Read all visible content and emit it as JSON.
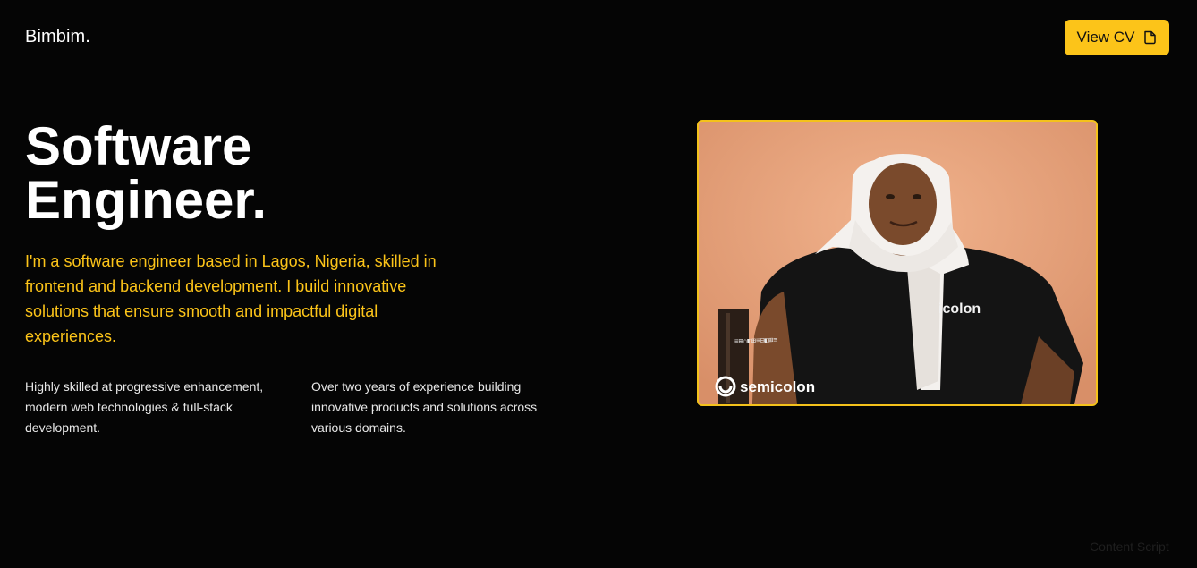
{
  "header": {
    "logo": "Bimbim.",
    "cv_button_label": "View CV"
  },
  "hero": {
    "headline_line1": "Software",
    "headline_line2": "Engineer.",
    "intro": "I'm a software engineer based in Lagos, Nigeria, skilled in frontend and backend development. I build innovative solutions that ensure smooth and impactful digital experiences.",
    "highlights": [
      "Highly skilled at progressive enhancement, modern web technologies & full-stack development.",
      "Over two years of experience building innovative products and solutions across various domains."
    ]
  },
  "photo": {
    "shirt_text": "icolon",
    "brand_text": "semicolon"
  },
  "footer": {
    "watermark": "Content Script"
  },
  "colors": {
    "background": "#050505",
    "accent": "#fcc419",
    "text": "#ffffff"
  },
  "icons": {
    "cv_button": "document-icon",
    "brand": "semicolon-logo-icon"
  }
}
